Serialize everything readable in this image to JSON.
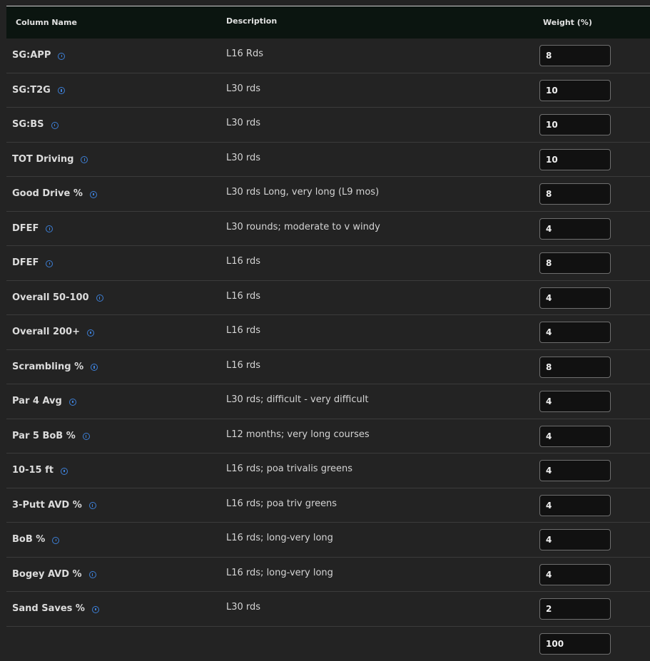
{
  "header": {
    "column_name": "Column Name",
    "description": "Description",
    "weight": "Weight (%)"
  },
  "rows": [
    {
      "name": "SG:APP",
      "desc": "L16 Rds",
      "weight": "8"
    },
    {
      "name": "SG:T2G",
      "desc": "L30 rds",
      "weight": "10"
    },
    {
      "name": "SG:BS",
      "desc": "L30 rds",
      "weight": "10"
    },
    {
      "name": "TOT Driving",
      "desc": "L30 rds",
      "weight": "10"
    },
    {
      "name": "Good Drive %",
      "desc": "L30 rds Long, very long (L9 mos)",
      "weight": "8"
    },
    {
      "name": "DFEF",
      "desc": "L30 rounds; moderate to v windy",
      "weight": "4"
    },
    {
      "name": "DFEF",
      "desc": "L16 rds",
      "weight": "8"
    },
    {
      "name": "Overall 50-100",
      "desc": "L16 rds",
      "weight": "4"
    },
    {
      "name": "Overall 200+",
      "desc": "L16 rds",
      "weight": "4"
    },
    {
      "name": "Scrambling %",
      "desc": "L16 rds",
      "weight": "8"
    },
    {
      "name": "Par 4 Avg",
      "desc": "L30 rds; difficult - very difficult",
      "weight": "4"
    },
    {
      "name": "Par 5 BoB %",
      "desc": "L12 months; very long courses",
      "weight": "4"
    },
    {
      "name": "10-15 ft",
      "desc": "L16 rds; poa trivalis greens",
      "weight": "4"
    },
    {
      "name": "3-Putt AVD %",
      "desc": "L16 rds; poa triv greens",
      "weight": "4"
    },
    {
      "name": "BoB %",
      "desc": "L16 rds; long-very long",
      "weight": "4"
    },
    {
      "name": "Bogey AVD %",
      "desc": "L16 rds; long-very long",
      "weight": "4"
    },
    {
      "name": "Sand Saves %",
      "desc": "L30 rds",
      "weight": "2"
    }
  ],
  "total": "100",
  "icon": "info-icon",
  "colors": {
    "background": "#232323",
    "header_bg": "#0b1510",
    "icon": "#3d7fd6"
  }
}
